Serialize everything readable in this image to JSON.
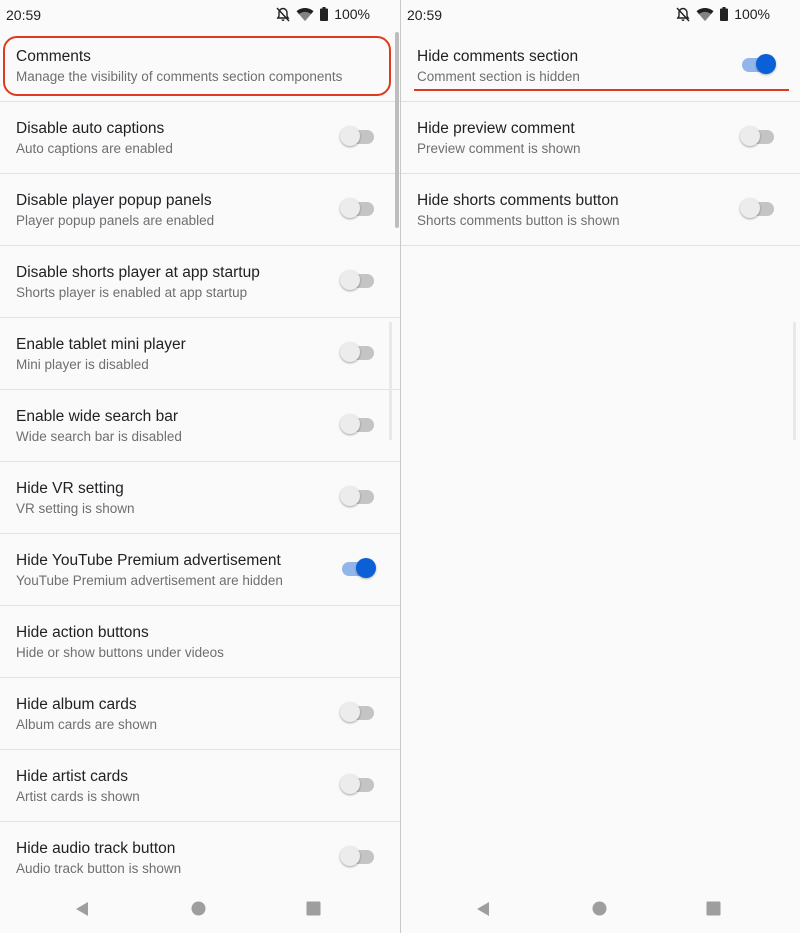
{
  "colors": {
    "accent": "#0b5fd7",
    "annotation": "#e03a1e",
    "toggle_off_track": "#c4c4c4"
  },
  "left_screen": {
    "status_bar": {
      "time": "20:59",
      "battery": "100%",
      "icons": [
        "bell-off-icon",
        "wifi-icon",
        "battery-icon"
      ]
    },
    "settings": [
      {
        "title": "Comments",
        "subtitle": "Manage the visibility of comments section components",
        "has_toggle": false
      },
      {
        "title": "Disable auto captions",
        "subtitle": "Auto captions are enabled",
        "has_toggle": true,
        "on": false
      },
      {
        "title": "Disable player popup panels",
        "subtitle": "Player popup panels are enabled",
        "has_toggle": true,
        "on": false
      },
      {
        "title": "Disable shorts player at app startup",
        "subtitle": "Shorts player is enabled at app startup",
        "has_toggle": true,
        "on": false
      },
      {
        "title": "Enable tablet mini player",
        "subtitle": "Mini player is disabled",
        "has_toggle": true,
        "on": false
      },
      {
        "title": "Enable wide search bar",
        "subtitle": "Wide search bar is disabled",
        "has_toggle": true,
        "on": false
      },
      {
        "title": "Hide VR setting",
        "subtitle": "VR setting is shown",
        "has_toggle": true,
        "on": false
      },
      {
        "title": "Hide YouTube Premium advertisement",
        "subtitle": "YouTube Premium advertisement are hidden",
        "has_toggle": true,
        "on": true
      },
      {
        "title": "Hide action buttons",
        "subtitle": "Hide or show buttons under videos",
        "has_toggle": false
      },
      {
        "title": "Hide album cards",
        "subtitle": "Album cards are shown",
        "has_toggle": true,
        "on": false
      },
      {
        "title": "Hide artist cards",
        "subtitle": "Artist cards is shown",
        "has_toggle": true,
        "on": false
      },
      {
        "title": "Hide audio track button",
        "subtitle": "Audio track button is shown",
        "has_toggle": true,
        "on": false
      }
    ]
  },
  "right_screen": {
    "status_bar": {
      "time": "20:59",
      "battery": "100%",
      "icons": [
        "bell-off-icon",
        "wifi-icon",
        "battery-icon"
      ]
    },
    "settings": [
      {
        "title": "Hide comments section",
        "subtitle": "Comment section is hidden",
        "has_toggle": true,
        "on": true
      },
      {
        "title": "Hide preview comment",
        "subtitle": "Preview comment is shown",
        "has_toggle": true,
        "on": false
      },
      {
        "title": "Hide shorts comments button",
        "subtitle": "Shorts comments button is shown",
        "has_toggle": true,
        "on": false
      }
    ]
  },
  "nav_bar": [
    "back-icon",
    "home-icon",
    "recents-icon"
  ]
}
